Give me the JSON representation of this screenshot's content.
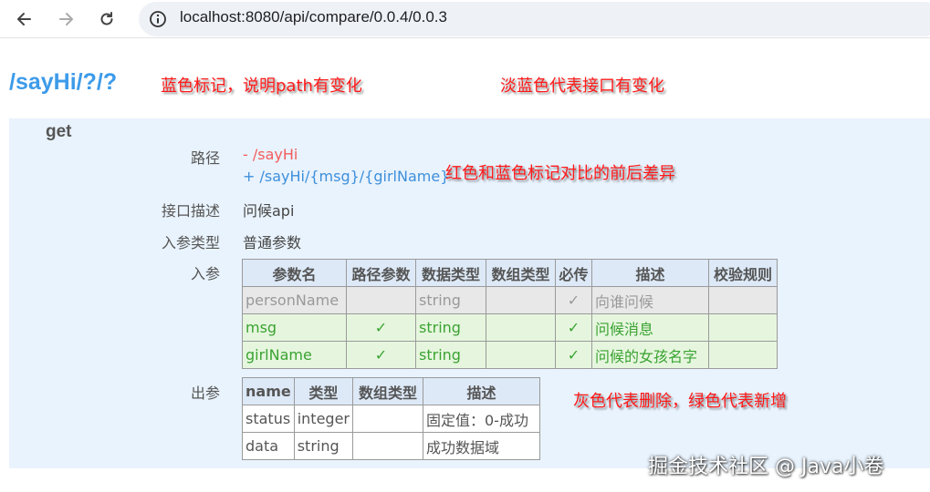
{
  "browser": {
    "url": "localhost:8080/api/compare/0.0.4/0.0.3",
    "icons": [
      "back-arrow-icon",
      "forward-arrow-icon",
      "reload-icon",
      "site-info-icon"
    ]
  },
  "page": {
    "route_title": "/sayHi/?/?",
    "method": "get"
  },
  "annotations": {
    "blue_mark": "蓝色标记，说明path有变化",
    "light_blue": "淡蓝色代表接口有变化",
    "red_blue_diff": "红色和蓝色标记对比的前后差异",
    "gray_green": "灰色代表删除，绿色代表新增"
  },
  "details": {
    "path_label": "路径",
    "path_old": "- /sayHi",
    "path_new": "+ /sayHi/{msg}/{girlName}",
    "desc_label": "接口描述",
    "desc_value": "问候api",
    "param_type_label": "入参类型",
    "param_type_value": "普通参数",
    "input_label": "入参",
    "output_label": "出参"
  },
  "input_table": {
    "headers": [
      "参数名",
      "路径参数",
      "数据类型",
      "数组类型",
      "必传",
      "描述",
      "校验规则"
    ],
    "rows": [
      {
        "status": "removed",
        "cells": [
          "personName",
          "",
          "string",
          "",
          "✓",
          "向谁问候",
          ""
        ]
      },
      {
        "status": "added",
        "cells": [
          "msg",
          "✓",
          "string",
          "",
          "✓",
          "问候消息",
          ""
        ]
      },
      {
        "status": "added",
        "cells": [
          "girlName",
          "✓",
          "string",
          "",
          "✓",
          "问候的女孩名字",
          ""
        ]
      }
    ]
  },
  "output_table": {
    "headers": [
      "name",
      "类型",
      "数组类型",
      "描述"
    ],
    "rows": [
      {
        "cells": [
          "status",
          "integer",
          "",
          "固定值：0-成功"
        ]
      },
      {
        "cells": [
          "data",
          "string",
          "",
          "成功数据域"
        ]
      }
    ]
  },
  "colors": {
    "title_blue": "#3d9be9",
    "panel_light_blue": "#e9f3fd",
    "removed_gray": "#e8e8e8",
    "added_green": "#e6f6de",
    "annotation_red": "#ff1a1a"
  },
  "watermark": "掘金技术社区 @ Java小卷"
}
